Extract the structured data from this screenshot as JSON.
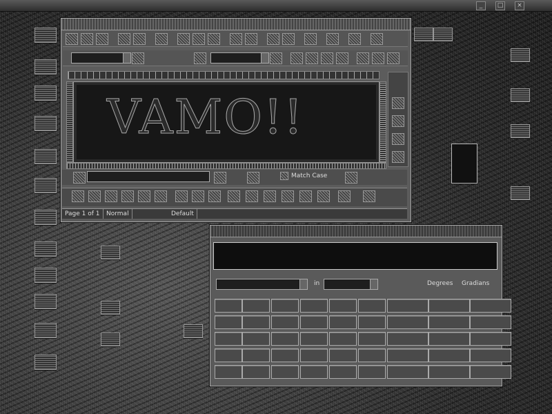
{
  "top_panel": {
    "controls": [
      "_",
      "□",
      "×"
    ]
  },
  "word_window": {
    "title": "",
    "style_combo": "",
    "font_combo": "",
    "document_text": "VAMO!!",
    "find_value": "",
    "match_case_label": "Match Case",
    "status": {
      "page": "Page 1 of 1",
      "style": "Normal",
      "mode": "Default"
    }
  },
  "calculator": {
    "title": "",
    "display_value": "",
    "convert_from": "",
    "in_label": "in",
    "convert_to": "",
    "degrees_label": "Degrees",
    "radians_label": "Gradians",
    "keys": [
      [
        "",
        "",
        "",
        "",
        "",
        "",
        "",
        "",
        ""
      ],
      [
        "",
        "",
        "",
        "",
        "",
        "",
        "",
        "",
        ""
      ],
      [
        "",
        "",
        "",
        "",
        "",
        "",
        "",
        "",
        ""
      ],
      [
        "",
        "",
        "",
        "",
        "",
        "",
        "",
        "",
        ""
      ],
      [
        "",
        "",
        "",
        "",
        "",
        "",
        "",
        "",
        ""
      ]
    ]
  }
}
